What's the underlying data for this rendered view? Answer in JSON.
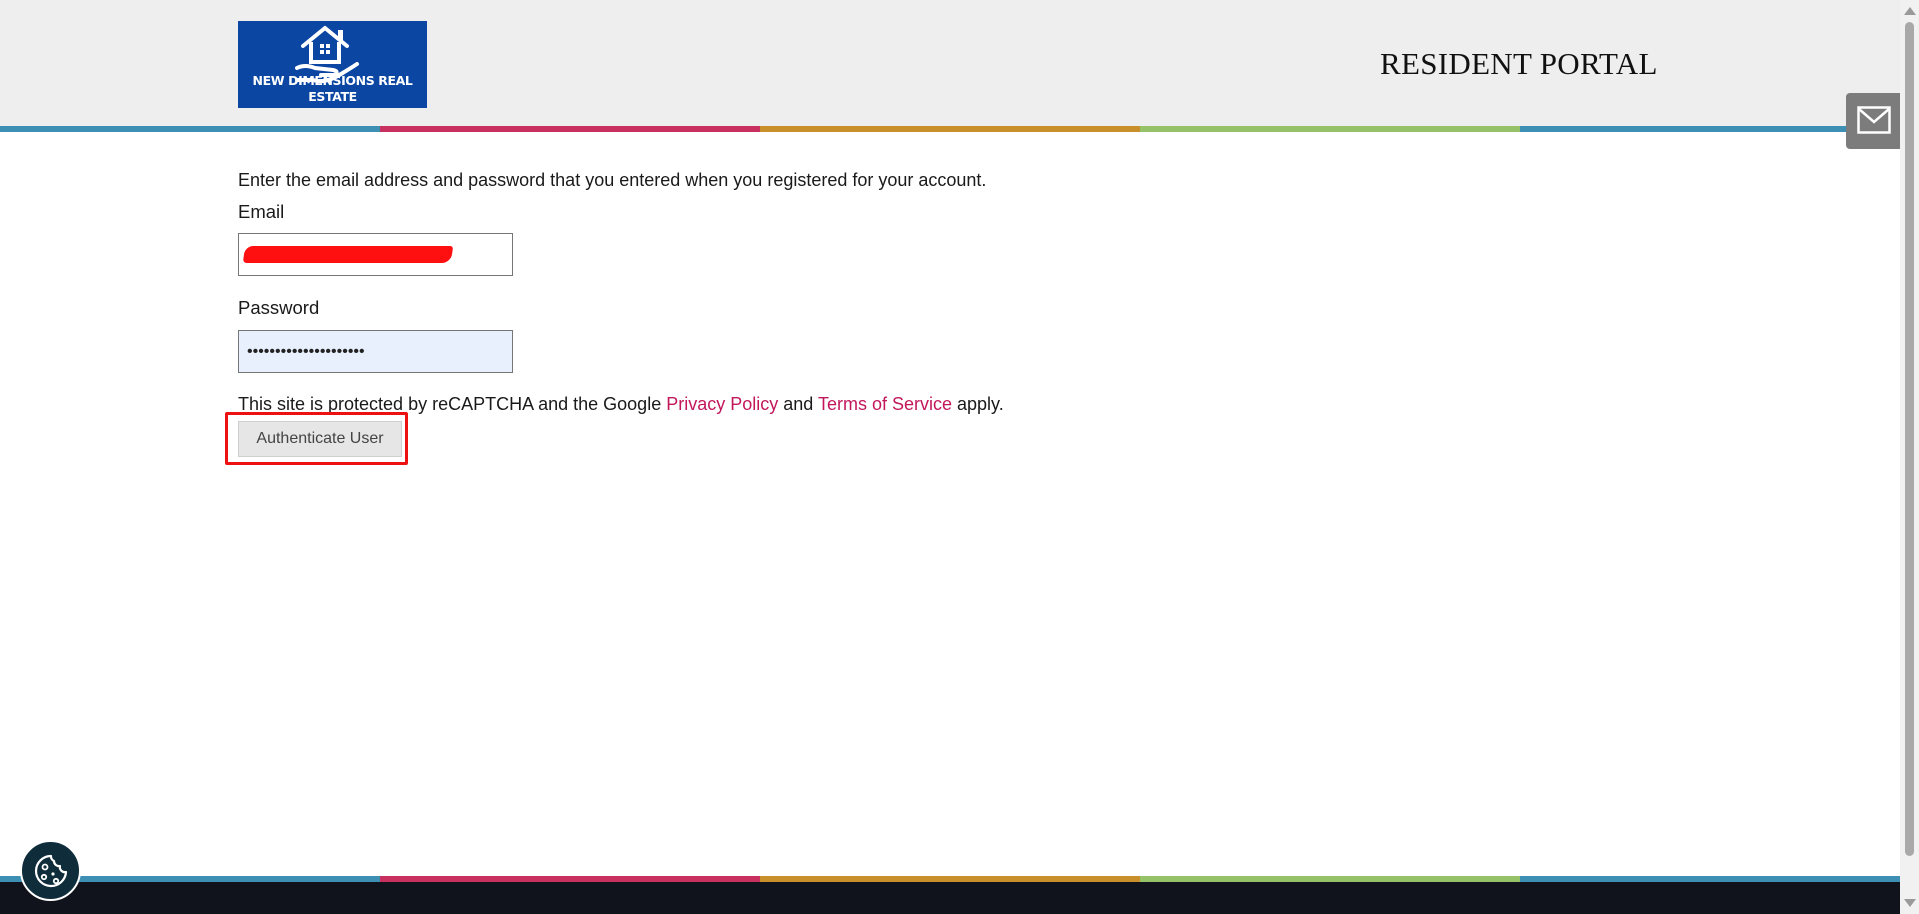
{
  "header": {
    "logo_text": "NEW DIMENSIONS REAL ESTATE",
    "portal_title": "RESIDENT PORTAL"
  },
  "login": {
    "instructions": "Enter the email address and password that you entered when you registered for your account.",
    "email_label": "Email",
    "email_value": "",
    "password_label": "Password",
    "password_value": "•••••••••••••••••••••"
  },
  "recaptcha": {
    "prefix": "This site is protected by reCAPTCHA and the Google ",
    "privacy_link": "Privacy Policy",
    "middle": " and ",
    "terms_link": "Terms of Service",
    "suffix": " apply."
  },
  "actions": {
    "authenticate_label": "Authenticate User"
  },
  "icons": {
    "logo": "house-in-hand-icon",
    "mail": "envelope-icon",
    "cookie": "cookie-icon"
  },
  "colors": {
    "stripe": [
      "#3d8fb3",
      "#c7305f",
      "#c98f2b",
      "#95c266",
      "#3d8fb3"
    ],
    "link": "#c2185b",
    "logo_bg": "#0b46a3",
    "footer": "#11131c",
    "highlight": "#ee1111"
  }
}
